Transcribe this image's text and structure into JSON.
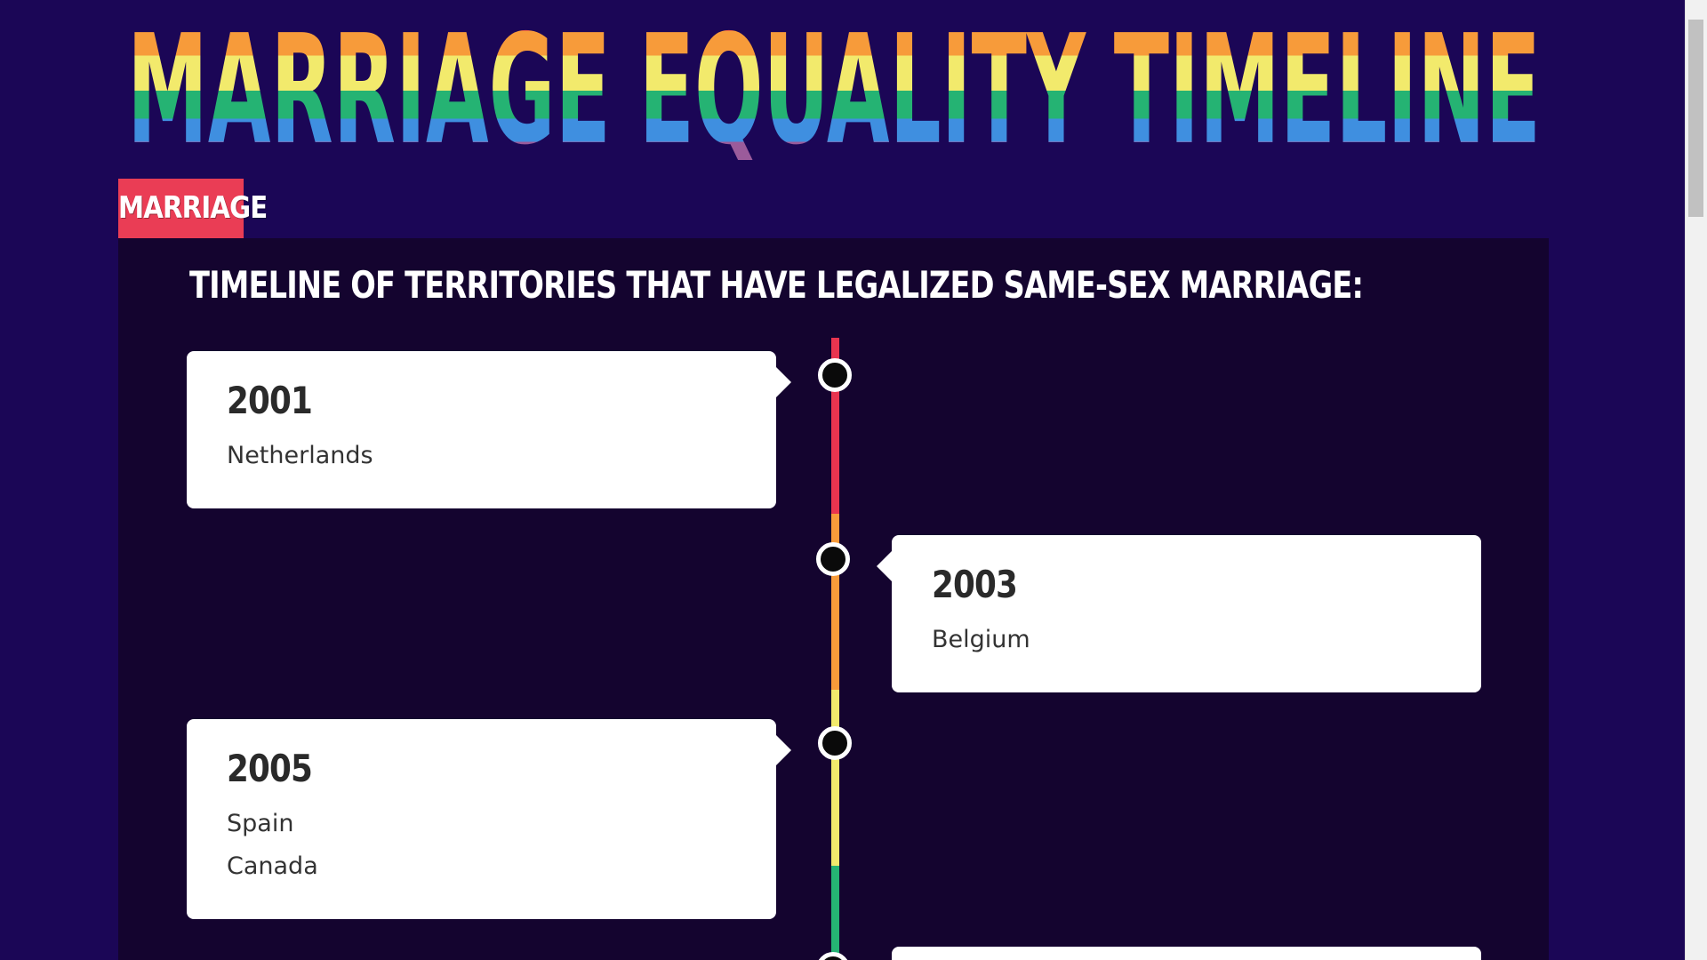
{
  "page": {
    "title": "MARRIAGE EQUALITY TIMELINE",
    "rainbow_colors": [
      "#e8344f",
      "#f79b3a",
      "#f2ea6c",
      "#25b373",
      "#3f8fe0",
      "#9b5b9b"
    ],
    "background": "#1b0656",
    "panel_background": "#14042f",
    "accent": "#ea3d55"
  },
  "tabs": [
    {
      "label": "MARRIAGE"
    }
  ],
  "section": {
    "heading": "TIMELINE OF TERRITORIES THAT HAVE LEGALIZED SAME-SEX MARRIAGE:"
  },
  "timeline": {
    "events": [
      {
        "year": "2001",
        "side": "left",
        "countries": [
          "Netherlands"
        ]
      },
      {
        "year": "2003",
        "side": "right",
        "countries": [
          "Belgium"
        ]
      },
      {
        "year": "2005",
        "side": "left",
        "countries": [
          "Spain",
          "Canada"
        ]
      }
    ]
  }
}
